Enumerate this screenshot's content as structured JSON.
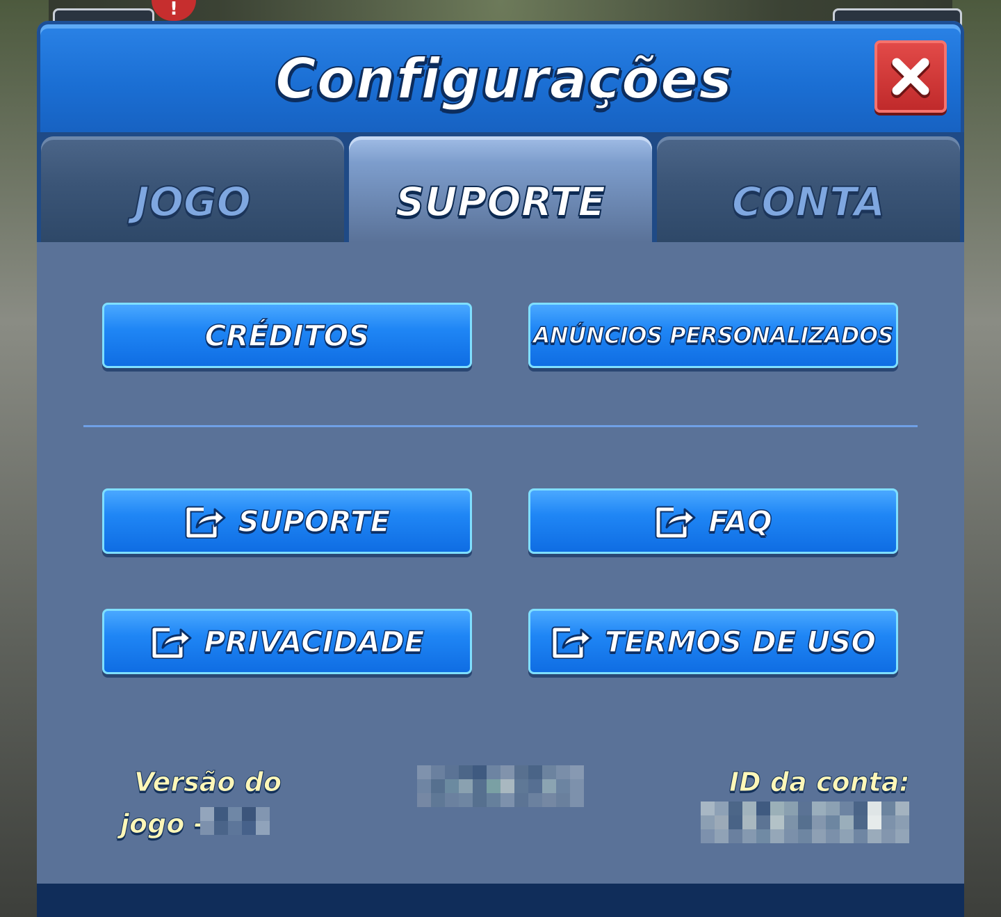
{
  "dialog": {
    "title": "Configurações",
    "close_icon": "close-x-icon"
  },
  "tabs": [
    {
      "label": "JOGO",
      "active": false
    },
    {
      "label": "SUPORTE",
      "active": true
    },
    {
      "label": "CONTA",
      "active": false
    }
  ],
  "buttons": {
    "credits": {
      "label": "CRÉDITOS"
    },
    "personalized_ads": {
      "label": "ANÚNCIOS PERSONALIZADOS"
    },
    "support": {
      "label": "SUPORTE",
      "icon": "external-link-icon"
    },
    "faq": {
      "label": "FAQ",
      "icon": "external-link-icon"
    },
    "privacy": {
      "label": "PRIVACIDADE",
      "icon": "external-link-icon"
    },
    "terms": {
      "label": "TERMOS DE USO",
      "icon": "external-link-icon"
    }
  },
  "footer": {
    "version_label_line1": "Versão do",
    "version_label_line2": "jogo -",
    "account_id_label": "ID da conta:"
  },
  "colors": {
    "header_blue": "#1b6fd4",
    "panel": "#5a7298",
    "button_blue": "#1f86f5",
    "close_red": "#c02a2b",
    "footer_text": "#fff7b8"
  }
}
